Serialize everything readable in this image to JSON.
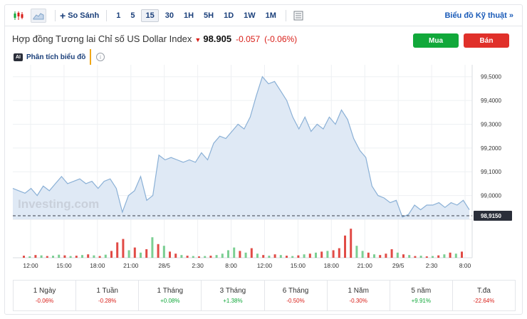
{
  "toolbar": {
    "compare_label": "So Sánh",
    "intervals": [
      "1",
      "5",
      "15",
      "30",
      "1H",
      "5H",
      "1D",
      "1W",
      "1M"
    ],
    "active_interval": "15",
    "tech_chart_link": "Biểu đồ Kỹ thuật »"
  },
  "header": {
    "title": "Hợp đồng Tương lai Chỉ số US Dollar Index",
    "price": "98.905",
    "change": "-0.057",
    "change_pct": "(-0.06%)",
    "buy_label": "Mua",
    "sell_label": "Bán"
  },
  "analysis": {
    "badge": "AI",
    "label": "Phân tích biểu đồ",
    "info": "i"
  },
  "watermark": "Investing.com",
  "colors": {
    "line": "#8ab0d6",
    "fill": "#dfe9f5",
    "up": "#11a83a",
    "down": "#d91e18",
    "buy": "#11a83a",
    "sell": "#e0302a"
  },
  "chart_data": {
    "type": "area",
    "y_ticks": [
      "99,5000",
      "99,4000",
      "99,3000",
      "99,2000",
      "99,1000",
      "99,0000"
    ],
    "ylim": [
      98.9,
      99.55
    ],
    "current_label": "98,9150",
    "current_value": 98.915,
    "x_ticks": [
      "12:00",
      "15:00",
      "18:00",
      "21:00",
      "28/5",
      "2:30",
      "8:00",
      "12:00",
      "15:00",
      "18:00",
      "21:00",
      "29/5",
      "2:30",
      "8:00"
    ],
    "series": [
      {
        "values": [
          99.03,
          99.02,
          99.01,
          99.03,
          99.0,
          99.04,
          99.02,
          99.05,
          99.08,
          99.05,
          99.06,
          99.07,
          99.05,
          99.06,
          99.03,
          99.06,
          99.07,
          99.03,
          98.93,
          99.0,
          99.02,
          99.08,
          98.98,
          99.0,
          99.17,
          99.15,
          99.16,
          99.15,
          99.14,
          99.15,
          99.14,
          99.18,
          99.15,
          99.22,
          99.25,
          99.24,
          99.27,
          99.3,
          99.28,
          99.33,
          99.42,
          99.5,
          99.47,
          99.48,
          99.44,
          99.4,
          99.33,
          99.28,
          99.33,
          99.27,
          99.3,
          99.28,
          99.33,
          99.3,
          99.36,
          99.32,
          99.24,
          99.19,
          99.16,
          99.04,
          99.0,
          98.99,
          98.97,
          98.98,
          98.91,
          98.92,
          98.96,
          98.94,
          98.96,
          98.96,
          98.97,
          98.95,
          98.97,
          98.96,
          98.98,
          98.94
        ]
      }
    ],
    "volume": [
      {
        "v": 0.06,
        "up": false
      },
      {
        "v": 0.04,
        "up": true
      },
      {
        "v": 0.08,
        "up": false
      },
      {
        "v": 0.07,
        "up": true
      },
      {
        "v": 0.05,
        "up": false
      },
      {
        "v": 0.06,
        "up": true
      },
      {
        "v": 0.09,
        "up": true
      },
      {
        "v": 0.07,
        "up": false
      },
      {
        "v": 0.05,
        "up": true
      },
      {
        "v": 0.06,
        "up": false
      },
      {
        "v": 0.08,
        "up": true
      },
      {
        "v": 0.1,
        "up": false
      },
      {
        "v": 0.07,
        "up": true
      },
      {
        "v": 0.05,
        "up": false
      },
      {
        "v": 0.09,
        "up": true
      },
      {
        "v": 0.2,
        "up": false
      },
      {
        "v": 0.45,
        "up": false
      },
      {
        "v": 0.55,
        "up": false
      },
      {
        "v": 0.22,
        "up": true
      },
      {
        "v": 0.3,
        "up": false
      },
      {
        "v": 0.15,
        "up": true
      },
      {
        "v": 0.25,
        "up": false
      },
      {
        "v": 0.6,
        "up": true
      },
      {
        "v": 0.4,
        "up": false
      },
      {
        "v": 0.35,
        "up": true
      },
      {
        "v": 0.18,
        "up": false
      },
      {
        "v": 0.12,
        "up": false
      },
      {
        "v": 0.08,
        "up": true
      },
      {
        "v": 0.06,
        "up": false
      },
      {
        "v": 0.05,
        "up": true
      },
      {
        "v": 0.04,
        "up": false
      },
      {
        "v": 0.05,
        "up": true
      },
      {
        "v": 0.06,
        "up": false
      },
      {
        "v": 0.08,
        "up": true
      },
      {
        "v": 0.12,
        "up": true
      },
      {
        "v": 0.22,
        "up": true
      },
      {
        "v": 0.3,
        "up": true
      },
      {
        "v": 0.2,
        "up": false
      },
      {
        "v": 0.15,
        "up": true
      },
      {
        "v": 0.28,
        "up": false
      },
      {
        "v": 0.12,
        "up": true
      },
      {
        "v": 0.08,
        "up": false
      },
      {
        "v": 0.06,
        "up": true
      },
      {
        "v": 0.1,
        "up": false
      },
      {
        "v": 0.08,
        "up": true
      },
      {
        "v": 0.06,
        "up": false
      },
      {
        "v": 0.05,
        "up": true
      },
      {
        "v": 0.07,
        "up": false
      },
      {
        "v": 0.1,
        "up": true
      },
      {
        "v": 0.12,
        "up": false
      },
      {
        "v": 0.15,
        "up": true
      },
      {
        "v": 0.18,
        "up": false
      },
      {
        "v": 0.2,
        "up": true
      },
      {
        "v": 0.22,
        "up": false
      },
      {
        "v": 0.28,
        "up": false
      },
      {
        "v": 0.65,
        "up": false
      },
      {
        "v": 0.85,
        "up": false
      },
      {
        "v": 0.35,
        "up": true
      },
      {
        "v": 0.2,
        "up": true
      },
      {
        "v": 0.15,
        "up": false
      },
      {
        "v": 0.1,
        "up": true
      },
      {
        "v": 0.08,
        "up": false
      },
      {
        "v": 0.12,
        "up": false
      },
      {
        "v": 0.25,
        "up": false
      },
      {
        "v": 0.15,
        "up": true
      },
      {
        "v": 0.1,
        "up": false
      },
      {
        "v": 0.08,
        "up": true
      },
      {
        "v": 0.05,
        "up": false
      },
      {
        "v": 0.06,
        "up": true
      },
      {
        "v": 0.04,
        "up": false
      },
      {
        "v": 0.05,
        "up": true
      },
      {
        "v": 0.07,
        "up": false
      },
      {
        "v": 0.1,
        "up": true
      },
      {
        "v": 0.15,
        "up": false
      },
      {
        "v": 0.12,
        "up": true
      },
      {
        "v": 0.18,
        "up": false
      }
    ]
  },
  "stats": [
    {
      "label": "1 Ngày",
      "value": "-0.06%",
      "dir": "neg"
    },
    {
      "label": "1 Tuần",
      "value": "-0.28%",
      "dir": "neg"
    },
    {
      "label": "1 Tháng",
      "value": "+0.08%",
      "dir": "pos"
    },
    {
      "label": "3 Tháng",
      "value": "+1.38%",
      "dir": "pos"
    },
    {
      "label": "6 Tháng",
      "value": "-0.50%",
      "dir": "neg"
    },
    {
      "label": "1 Năm",
      "value": "-0.30%",
      "dir": "neg"
    },
    {
      "label": "5 năm",
      "value": "+9.91%",
      "dir": "pos"
    },
    {
      "label": "T.đa",
      "value": "-22.64%",
      "dir": "neg"
    }
  ]
}
